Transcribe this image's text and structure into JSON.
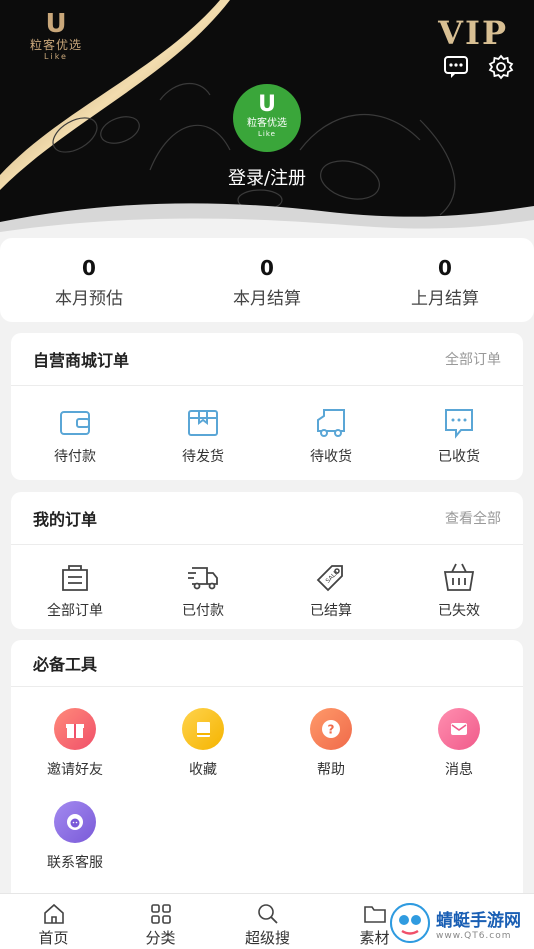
{
  "header": {
    "brand_name": "粒客优选",
    "brand_sub": "Like",
    "vip_label": "VIP",
    "avatar_name": "粒客优选",
    "avatar_sub": "Like",
    "login_label": "登录/注册",
    "icons": [
      "chat-icon",
      "gear-icon"
    ]
  },
  "stats": [
    {
      "value": "0",
      "label": "本月预估"
    },
    {
      "value": "0",
      "label": "本月结算"
    },
    {
      "value": "0",
      "label": "上月结算"
    }
  ],
  "mall_orders": {
    "title": "自营商城订单",
    "more": "全部订单",
    "items": [
      {
        "label": "待付款",
        "icon": "wallet-icon"
      },
      {
        "label": "待发货",
        "icon": "package-icon"
      },
      {
        "label": "待收货",
        "icon": "truck-icon"
      },
      {
        "label": "已收货",
        "icon": "message-box-icon"
      }
    ]
  },
  "my_orders": {
    "title": "我的订单",
    "more": "查看全部",
    "items": [
      {
        "label": "全部订单",
        "icon": "bag-icon"
      },
      {
        "label": "已付款",
        "icon": "delivery-icon"
      },
      {
        "label": "已结算",
        "icon": "sale-tag-icon"
      },
      {
        "label": "已失效",
        "icon": "basket-icon"
      }
    ]
  },
  "tools": {
    "title": "必备工具",
    "items": [
      {
        "label": "邀请好友",
        "icon": "gift-icon"
      },
      {
        "label": "收藏",
        "icon": "book-icon"
      },
      {
        "label": "帮助",
        "icon": "question-icon"
      },
      {
        "label": "消息",
        "icon": "mail-icon"
      },
      {
        "label": "联系客服",
        "icon": "service-icon"
      }
    ]
  },
  "tabbar": [
    {
      "label": "首页",
      "icon": "home-icon"
    },
    {
      "label": "分类",
      "icon": "grid-icon"
    },
    {
      "label": "超级搜",
      "icon": "search-icon"
    },
    {
      "label": "素材",
      "icon": "folder-icon"
    }
  ],
  "watermark": {
    "main": "蜻蜓手游网",
    "sub": "www.QT6.com"
  },
  "colors": {
    "avatar": "#3aa63a",
    "gold": "#d8bf93",
    "icon_blue": "#5aa6d6"
  }
}
